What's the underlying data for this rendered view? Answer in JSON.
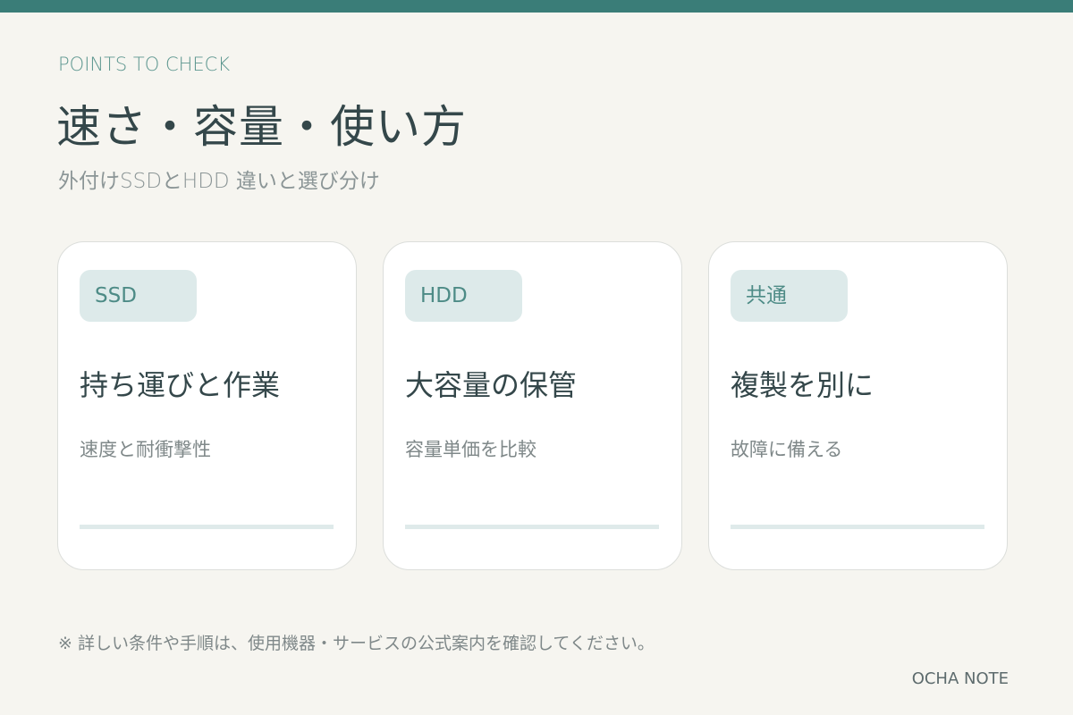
{
  "header": {
    "eyebrow": "POINTS TO CHECK",
    "title": "速さ・容量・使い方",
    "subtitle": "外付けSSDとHDD 違いと選び分け"
  },
  "cards": [
    {
      "tag": "SSD",
      "heading": "持ち運びと作業",
      "description": "速度と耐衝撃性"
    },
    {
      "tag": "HDD",
      "heading": "大容量の保管",
      "description": "容量単価を比較"
    },
    {
      "tag": "共通",
      "heading": "複製を別に",
      "description": "故障に備える"
    }
  ],
  "footer": {
    "note": "※ 詳しい条件や手順は、使用機器・サービスの公式案内を確認してください。",
    "brand": "OCHA NOTE"
  },
  "colors": {
    "accent": "#3a7d78",
    "background": "#f6f5f0",
    "tag_background": "#ddeaea",
    "tag_text": "#4d8b86",
    "card_rule": "#dfeaea"
  }
}
